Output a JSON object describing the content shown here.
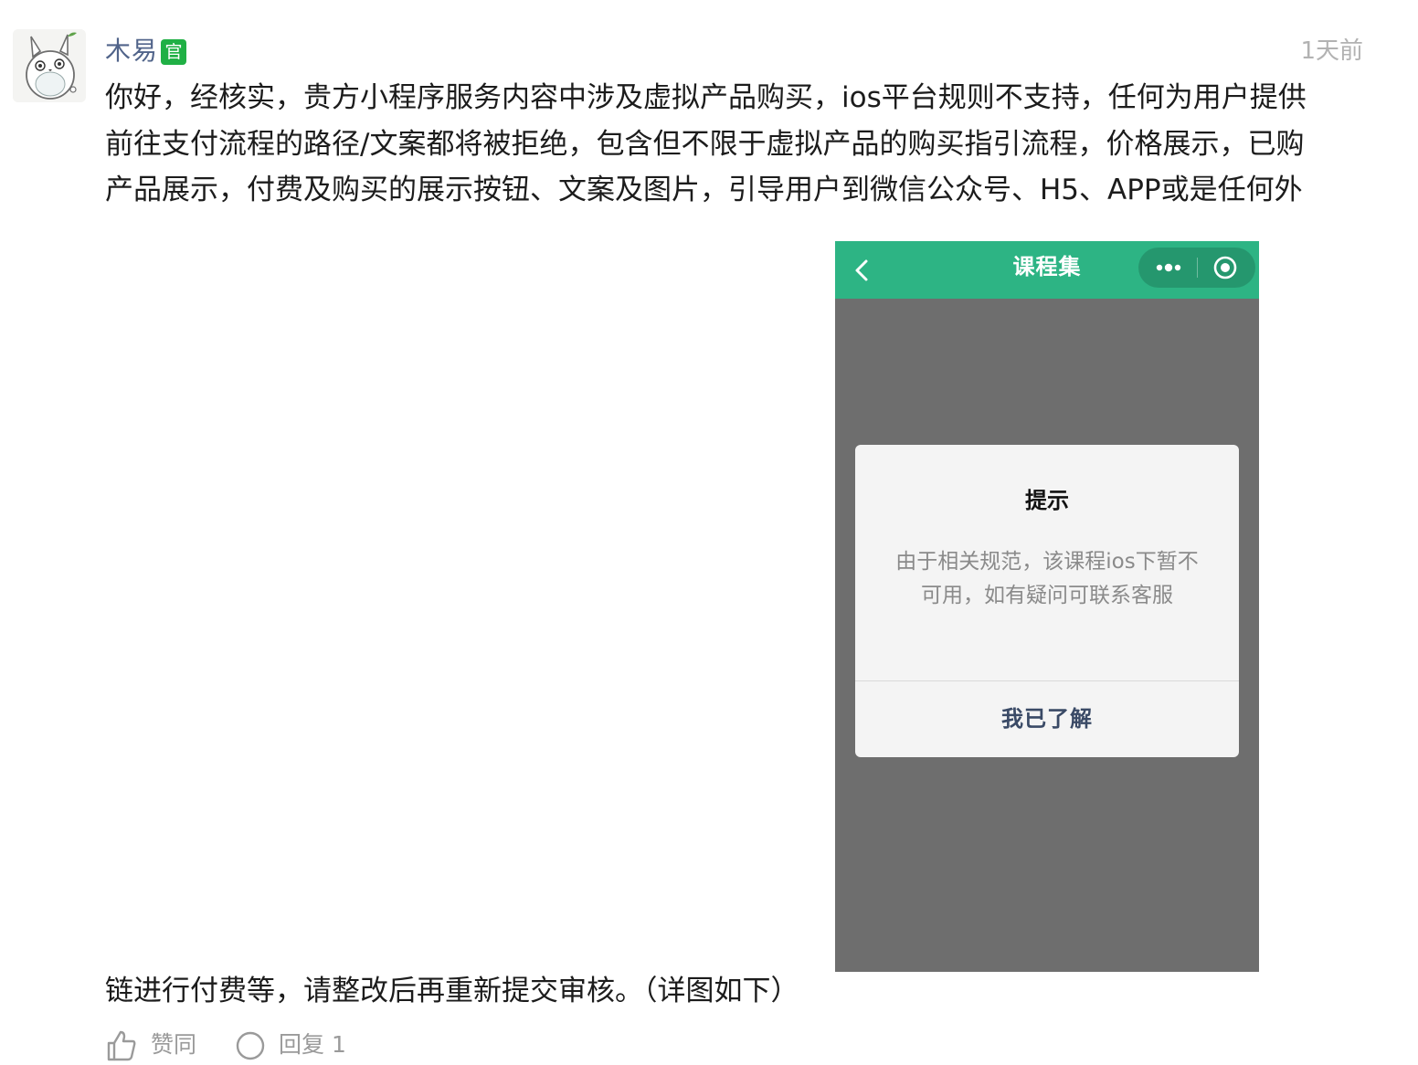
{
  "comment": {
    "author": "木易",
    "official_badge": "官",
    "time": "1天前",
    "text_lines": [
      "你好，经核实，贵方小程序服务内容中涉及虚拟产品购买，ios平台规则不支持，任何为用户提供",
      "前往支付流程的路径/文案都将被拒绝，包含但不限于虚拟产品的购买指引流程，价格展示，已购",
      "产品展示，付费及购买的展示按钮、文案及图片，引导用户到微信公众号、H5、APP或是任何外"
    ],
    "text_tail": "链进行付费等，请整改后再重新提交审核。（详图如下）"
  },
  "screenshot": {
    "nav_title": "课程集",
    "dialog": {
      "title": "提示",
      "message": "由于相关规范，该课程ios下暂不可用，如有疑问可联系客服",
      "confirm": "我已了解"
    }
  },
  "actions": {
    "like_label": "赞同",
    "reply_label": "回复 1"
  },
  "colors": {
    "author_name": "#51648a",
    "badge": "#20b045",
    "nav_bar": "#2db484",
    "mask": "#6e6e6e"
  }
}
